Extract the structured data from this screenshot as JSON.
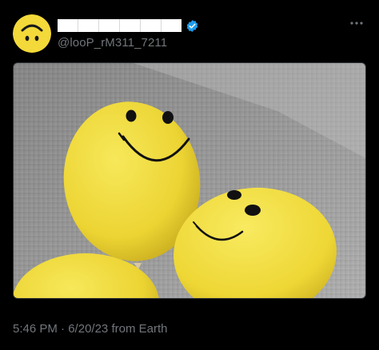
{
  "tweet": {
    "handle": "@looP_rM311_7211",
    "display_name_redacted": true,
    "verified": true,
    "avatar_icon": "upside-down-smiley-icon",
    "more_icon": "more-options-icon",
    "media_alt": "",
    "time": "5:46 PM",
    "separator": "·",
    "date": "6/20/23",
    "source": "from Earth"
  },
  "colors": {
    "background": "#000000",
    "muted_text": "#71767b",
    "verified_blue": "#1d9bf0",
    "balloon_yellow": "#f1dd3a"
  }
}
